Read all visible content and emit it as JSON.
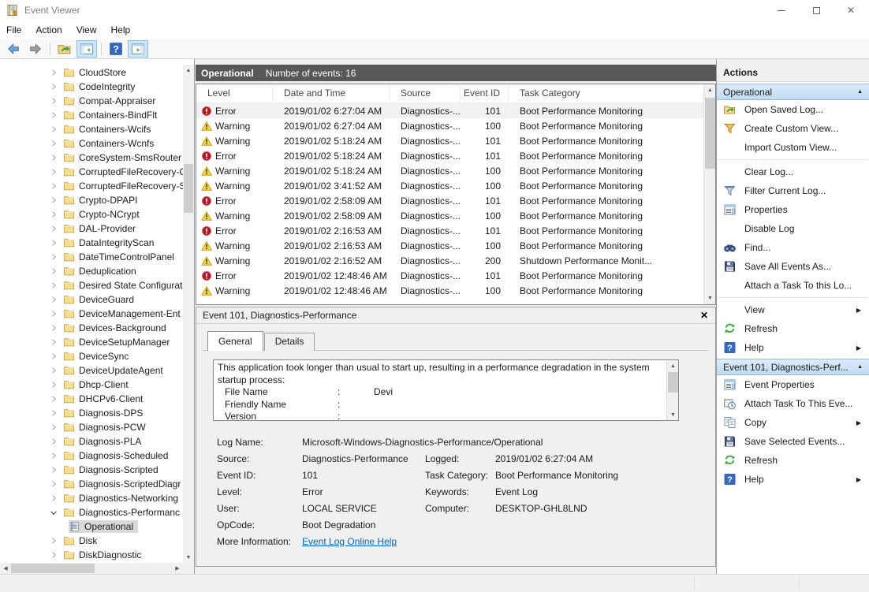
{
  "window": {
    "title": "Event Viewer"
  },
  "menu_bar": {
    "items": [
      "File",
      "Action",
      "View",
      "Help"
    ]
  },
  "toolbar": {
    "buttons": [
      {
        "name": "back-button",
        "icon": "arrow-left"
      },
      {
        "name": "forward-button",
        "icon": "arrow-right"
      },
      {
        "sep": true
      },
      {
        "name": "export-list-button",
        "icon": "folder-open"
      },
      {
        "name": "show-console-tree-toggle",
        "icon": "window-tree",
        "active": true
      },
      {
        "sep": true
      },
      {
        "name": "help-button",
        "icon": "help"
      },
      {
        "name": "show-action-pane-toggle",
        "icon": "window-pane",
        "active": true
      }
    ]
  },
  "tree": {
    "items": [
      {
        "label": "CloudStore",
        "state": "collapsed",
        "icon": "folder"
      },
      {
        "label": "CodeIntegrity",
        "state": "collapsed",
        "icon": "folder"
      },
      {
        "label": "Compat-Appraiser",
        "state": "collapsed",
        "icon": "folder"
      },
      {
        "label": "Containers-BindFlt",
        "state": "collapsed",
        "icon": "folder"
      },
      {
        "label": "Containers-Wcifs",
        "state": "collapsed",
        "icon": "folder"
      },
      {
        "label": "Containers-Wcnfs",
        "state": "collapsed",
        "icon": "folder"
      },
      {
        "label": "CoreSystem-SmsRouter",
        "state": "collapsed",
        "icon": "folder"
      },
      {
        "label": "CorruptedFileRecovery-C",
        "state": "collapsed",
        "icon": "folder"
      },
      {
        "label": "CorruptedFileRecovery-S",
        "state": "collapsed",
        "icon": "folder"
      },
      {
        "label": "Crypto-DPAPI",
        "state": "collapsed",
        "icon": "folder"
      },
      {
        "label": "Crypto-NCrypt",
        "state": "collapsed",
        "icon": "folder"
      },
      {
        "label": "DAL-Provider",
        "state": "collapsed",
        "icon": "folder"
      },
      {
        "label": "DataIntegrityScan",
        "state": "collapsed",
        "icon": "folder"
      },
      {
        "label": "DateTimeControlPanel",
        "state": "collapsed",
        "icon": "folder"
      },
      {
        "label": "Deduplication",
        "state": "collapsed",
        "icon": "folder"
      },
      {
        "label": "Desired State Configurat",
        "state": "collapsed",
        "icon": "folder"
      },
      {
        "label": "DeviceGuard",
        "state": "collapsed",
        "icon": "folder"
      },
      {
        "label": "DeviceManagement-Ent",
        "state": "collapsed",
        "icon": "folder"
      },
      {
        "label": "Devices-Background",
        "state": "collapsed",
        "icon": "folder"
      },
      {
        "label": "DeviceSetupManager",
        "state": "collapsed",
        "icon": "folder"
      },
      {
        "label": "DeviceSync",
        "state": "collapsed",
        "icon": "folder"
      },
      {
        "label": "DeviceUpdateAgent",
        "state": "collapsed",
        "icon": "folder"
      },
      {
        "label": "Dhcp-Client",
        "state": "collapsed",
        "icon": "folder"
      },
      {
        "label": "DHCPv6-Client",
        "state": "collapsed",
        "icon": "folder"
      },
      {
        "label": "Diagnosis-DPS",
        "state": "collapsed",
        "icon": "folder"
      },
      {
        "label": "Diagnosis-PCW",
        "state": "collapsed",
        "icon": "folder"
      },
      {
        "label": "Diagnosis-PLA",
        "state": "collapsed",
        "icon": "folder"
      },
      {
        "label": "Diagnosis-Scheduled",
        "state": "collapsed",
        "icon": "folder"
      },
      {
        "label": "Diagnosis-Scripted",
        "state": "collapsed",
        "icon": "folder"
      },
      {
        "label": "Diagnosis-ScriptedDiagr",
        "state": "collapsed",
        "icon": "folder"
      },
      {
        "label": "Diagnostics-Networking",
        "state": "collapsed",
        "icon": "folder"
      },
      {
        "label": "Diagnostics-Performanc",
        "state": "expanded",
        "icon": "folder"
      },
      {
        "label": "Operational",
        "state": "leaf",
        "icon": "log",
        "selected": true,
        "child": true
      },
      {
        "label": "Disk",
        "state": "collapsed",
        "icon": "folder"
      },
      {
        "label": "DiskDiagnostic",
        "state": "collapsed",
        "icon": "folder"
      }
    ]
  },
  "events": {
    "title": "Operational",
    "count_label": "Number of events: 16",
    "columns": [
      "Level",
      "Date and Time",
      "Source",
      "Event ID",
      "Task Category"
    ],
    "rows": [
      {
        "level": "Error",
        "icon": "error",
        "datetime": "2019/01/02 6:27:04 AM",
        "source": "Diagnostics-...",
        "event_id": "101",
        "task": "Boot Performance Monitoring",
        "selected": true
      },
      {
        "level": "Warning",
        "icon": "warning",
        "datetime": "2019/01/02 6:27:04 AM",
        "source": "Diagnostics-...",
        "event_id": "100",
        "task": "Boot Performance Monitoring"
      },
      {
        "level": "Warning",
        "icon": "warning",
        "datetime": "2019/01/02 5:18:24 AM",
        "source": "Diagnostics-...",
        "event_id": "101",
        "task": "Boot Performance Monitoring"
      },
      {
        "level": "Error",
        "icon": "error",
        "datetime": "2019/01/02 5:18:24 AM",
        "source": "Diagnostics-...",
        "event_id": "101",
        "task": "Boot Performance Monitoring"
      },
      {
        "level": "Warning",
        "icon": "warning",
        "datetime": "2019/01/02 5:18:24 AM",
        "source": "Diagnostics-...",
        "event_id": "100",
        "task": "Boot Performance Monitoring"
      },
      {
        "level": "Warning",
        "icon": "warning",
        "datetime": "2019/01/02 3:41:52 AM",
        "source": "Diagnostics-...",
        "event_id": "100",
        "task": "Boot Performance Monitoring"
      },
      {
        "level": "Error",
        "icon": "error",
        "datetime": "2019/01/02 2:58:09 AM",
        "source": "Diagnostics-...",
        "event_id": "101",
        "task": "Boot Performance Monitoring"
      },
      {
        "level": "Warning",
        "icon": "warning",
        "datetime": "2019/01/02 2:58:09 AM",
        "source": "Diagnostics-...",
        "event_id": "100",
        "task": "Boot Performance Monitoring"
      },
      {
        "level": "Error",
        "icon": "error",
        "datetime": "2019/01/02 2:16:53 AM",
        "source": "Diagnostics-...",
        "event_id": "101",
        "task": "Boot Performance Monitoring"
      },
      {
        "level": "Warning",
        "icon": "warning",
        "datetime": "2019/01/02 2:16:53 AM",
        "source": "Diagnostics-...",
        "event_id": "100",
        "task": "Boot Performance Monitoring"
      },
      {
        "level": "Warning",
        "icon": "warning",
        "datetime": "2019/01/02 2:16:52 AM",
        "source": "Diagnostics-...",
        "event_id": "200",
        "task": "Shutdown Performance Monit..."
      },
      {
        "level": "Error",
        "icon": "error",
        "datetime": "2019/01/02 12:48:46 AM",
        "source": "Diagnostics-...",
        "event_id": "101",
        "task": "Boot Performance Monitoring"
      },
      {
        "level": "Warning",
        "icon": "warning",
        "datetime": "2019/01/02 12:48:46 AM",
        "source": "Diagnostics-...",
        "event_id": "100",
        "task": "Boot Performance Monitoring"
      }
    ]
  },
  "details": {
    "title": "Event 101, Diagnostics-Performance",
    "close_label": "✕",
    "tabs": [
      "General",
      "Details"
    ],
    "active_tab": "General",
    "description": {
      "intro": "This application took longer than usual to start up, resulting in a performance degradation in the system startup process:",
      "fields": [
        {
          "label": "File Name",
          "value": "Devi"
        },
        {
          "label": "Friendly Name",
          "value": ""
        },
        {
          "label": "Version",
          "value": ""
        }
      ]
    },
    "fields": [
      {
        "l1": "Log Name:",
        "v1": "Microsoft-Windows-Diagnostics-Performance/Operational",
        "l2": "",
        "v2": "",
        "wide": true
      },
      {
        "l1": "Source:",
        "v1": "Diagnostics-Performance",
        "l2": "Logged:",
        "v2": "2019/01/02 6:27:04 AM"
      },
      {
        "l1": "Event ID:",
        "v1": "101",
        "l2": "Task Category:",
        "v2": "Boot Performance Monitoring"
      },
      {
        "l1": "Level:",
        "v1": "Error",
        "l2": "Keywords:",
        "v2": "Event Log"
      },
      {
        "l1": "User:",
        "v1": "LOCAL SERVICE",
        "l2": "Computer:",
        "v2": "DESKTOP-GHL8LND"
      },
      {
        "l1": "OpCode:",
        "v1": "Boot Degradation",
        "l2": "",
        "v2": ""
      },
      {
        "l1": "More Information:",
        "v1": "Event Log Online Help",
        "l2": "",
        "v2": "",
        "link": true
      }
    ]
  },
  "actions": {
    "title": "Actions",
    "collapse_glyph": "▲",
    "submenu_glyph": "▶",
    "sections": [
      {
        "header": "Operational",
        "items": [
          {
            "icon": "folder-open",
            "label": "Open Saved Log..."
          },
          {
            "icon": "filter-create",
            "label": "Create Custom View..."
          },
          {
            "icon": "",
            "label": "Import Custom View..."
          },
          {
            "sep": true
          },
          {
            "icon": "",
            "label": "Clear Log..."
          },
          {
            "icon": "filter",
            "label": "Filter Current Log..."
          },
          {
            "icon": "properties",
            "label": "Properties"
          },
          {
            "icon": "",
            "label": "Disable Log"
          },
          {
            "icon": "find",
            "label": "Find..."
          },
          {
            "icon": "save",
            "label": "Save All Events As..."
          },
          {
            "icon": "",
            "label": "Attach a Task To this Lo..."
          },
          {
            "sep": true
          },
          {
            "icon": "",
            "label": "View",
            "submenu": true
          },
          {
            "icon": "refresh",
            "label": "Refresh"
          },
          {
            "icon": "help",
            "label": "Help",
            "submenu": true
          }
        ]
      },
      {
        "header": "Event 101, Diagnostics-Perf...",
        "items": [
          {
            "icon": "properties",
            "label": "Event Properties"
          },
          {
            "icon": "task",
            "label": "Attach Task To This Eve..."
          },
          {
            "icon": "copy",
            "label": "Copy",
            "submenu": true
          },
          {
            "icon": "save",
            "label": "Save Selected Events..."
          },
          {
            "icon": "refresh",
            "label": "Refresh"
          },
          {
            "icon": "help",
            "label": "Help",
            "submenu": true
          }
        ]
      }
    ]
  },
  "colors": {
    "header_bar": "#57585a",
    "selection_inactive": "#d9d9d9",
    "section_header_top": "#dcebfa",
    "section_header_bottom": "#c0dbf3",
    "link": "#0563c1",
    "error_icon": "#ad1c28",
    "warning_icon": "#fcd33c"
  }
}
